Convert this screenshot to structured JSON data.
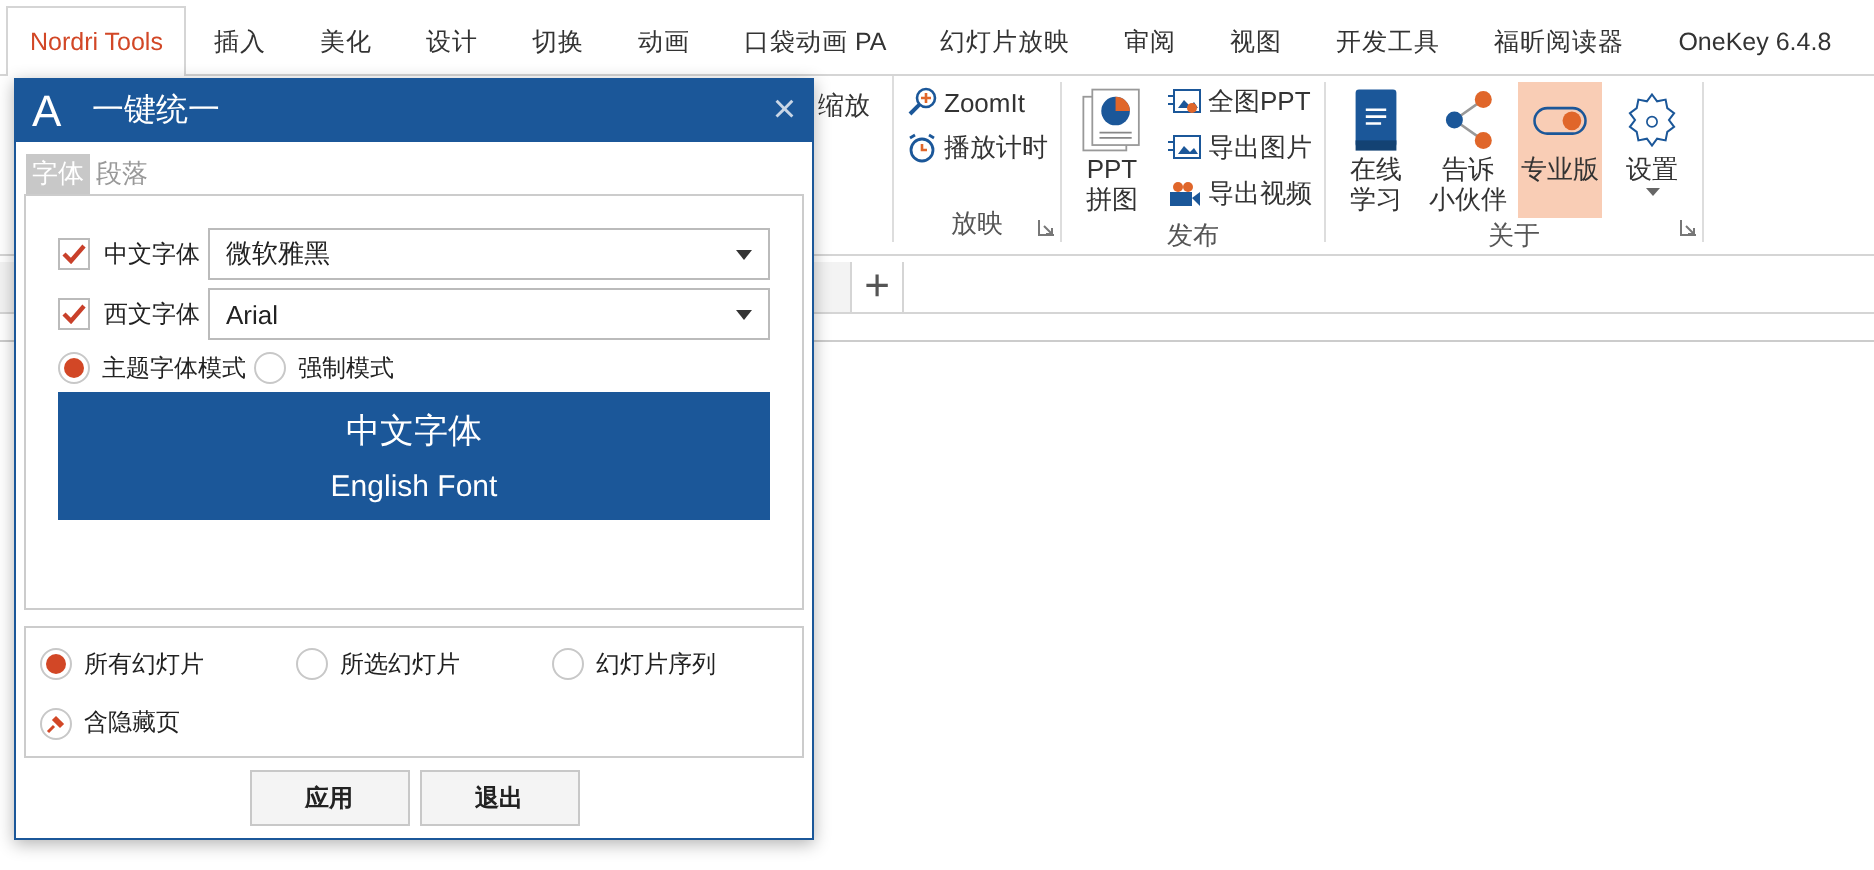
{
  "tabs": [
    {
      "label": "Nordri Tools",
      "selected": true
    },
    {
      "label": "插入",
      "selected": false
    },
    {
      "label": "美化",
      "selected": false
    },
    {
      "label": "设计",
      "selected": false
    },
    {
      "label": "切换",
      "selected": false
    },
    {
      "label": "动画",
      "selected": false
    },
    {
      "label": "口袋动画 PA",
      "selected": false
    },
    {
      "label": "幻灯片放映",
      "selected": false
    },
    {
      "label": "审阅",
      "selected": false
    },
    {
      "label": "视图",
      "selected": false
    },
    {
      "label": "开发工具",
      "selected": false
    },
    {
      "label": "福昕阅读器",
      "selected": false
    },
    {
      "label": "OneKey 6.4.8",
      "selected": false
    }
  ],
  "ribbon": {
    "partial_label": "缩放",
    "groups": [
      {
        "label": "放映",
        "launcher": true,
        "items": [
          {
            "kind": "small",
            "label": "ZoomIt",
            "selected": false
          },
          {
            "kind": "small",
            "label": "播放计时",
            "selected": false
          }
        ]
      },
      {
        "label": "发布",
        "items": [
          {
            "kind": "large",
            "lines": [
              "PPT",
              "拼图"
            ],
            "selected": false
          },
          {
            "kind": "small",
            "label": "全图PPT",
            "selected": false
          },
          {
            "kind": "small",
            "label": "导出图片",
            "selected": false
          },
          {
            "kind": "small",
            "label": "导出视频",
            "selected": false
          }
        ]
      },
      {
        "label": "关于",
        "launcher": true,
        "items": [
          {
            "kind": "large",
            "lines": [
              "在线",
              "学习"
            ],
            "selected": false
          },
          {
            "kind": "large",
            "lines": [
              "告诉",
              "小伙伴"
            ],
            "selected": false
          },
          {
            "kind": "large",
            "lines": [
              "专业版"
            ],
            "selected": true
          },
          {
            "kind": "large",
            "lines": [
              "设置"
            ],
            "selected": false,
            "menu": true
          }
        ]
      }
    ]
  },
  "sheet_tabs": {
    "add": "+"
  },
  "dialog": {
    "title_icon": "A",
    "title": "一键统一",
    "close": "×",
    "tabs": [
      {
        "label": "字体",
        "selected": true
      },
      {
        "label": "段落",
        "selected": false
      }
    ],
    "font_rows": [
      {
        "label": "中文字体",
        "checked": true,
        "value": "微软雅黑"
      },
      {
        "label": "西文字体",
        "checked": true,
        "value": "Arial"
      }
    ],
    "modes": [
      {
        "label": "主题字体模式",
        "selected": true
      },
      {
        "label": "强制模式",
        "selected": false
      }
    ],
    "preview": {
      "chinese": "中文字体",
      "english": "English Font"
    },
    "scope": [
      {
        "label": "所有幻灯片",
        "selected": true
      },
      {
        "label": "所选幻灯片",
        "selected": false
      },
      {
        "label": "幻灯片序列",
        "selected": false
      }
    ],
    "include_hidden": {
      "label": "含隐藏页",
      "checked": true
    },
    "buttons": [
      "应用",
      "退出"
    ]
  }
}
